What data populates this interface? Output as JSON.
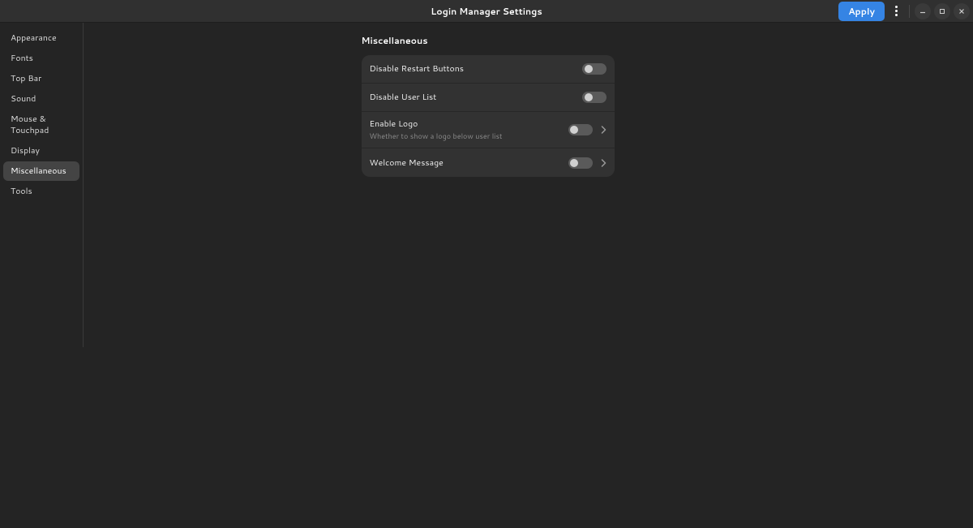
{
  "header": {
    "title": "Login Manager Settings",
    "apply_label": "Apply"
  },
  "sidebar": {
    "items": [
      {
        "label": "Appearance",
        "active": false
      },
      {
        "label": "Fonts",
        "active": false
      },
      {
        "label": "Top Bar",
        "active": false
      },
      {
        "label": "Sound",
        "active": false
      },
      {
        "label": "Mouse & Touchpad",
        "active": false
      },
      {
        "label": "Display",
        "active": false
      },
      {
        "label": "Miscellaneous",
        "active": true
      },
      {
        "label": "Tools",
        "active": false
      }
    ]
  },
  "content": {
    "section_title": "Miscellaneous",
    "rows": [
      {
        "title": "Disable Restart Buttons",
        "subtitle": "",
        "has_chevron": false,
        "switch_state": "off"
      },
      {
        "title": "Disable User List",
        "subtitle": "",
        "has_chevron": false,
        "switch_state": "off"
      },
      {
        "title": "Enable Logo",
        "subtitle": "Whether to show a logo below user list",
        "has_chevron": true,
        "switch_state": "off"
      },
      {
        "title": "Welcome Message",
        "subtitle": "",
        "has_chevron": true,
        "switch_state": "off"
      }
    ]
  }
}
